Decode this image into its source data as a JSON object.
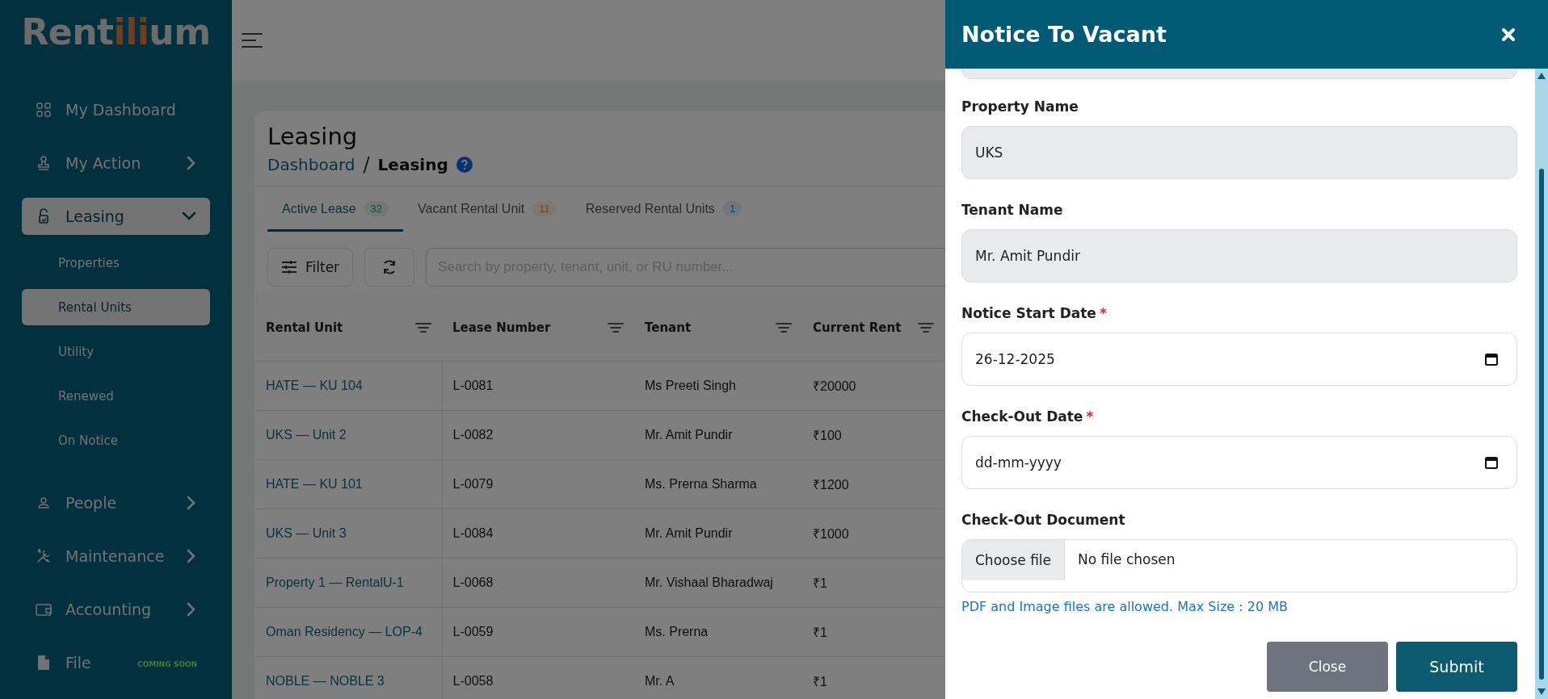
{
  "sidebar": {
    "logo": {
      "start": "Rent",
      "accent": "ili",
      "end": "um"
    },
    "items": [
      {
        "label": "My Dashboard",
        "selected": false
      },
      {
        "label": "My Action",
        "selected": false,
        "expanded": false
      },
      {
        "label": "Leasing",
        "selected": true,
        "expanded": true,
        "children": [
          {
            "label": "Properties",
            "selected": false
          },
          {
            "label": "Rental Units",
            "selected": true
          },
          {
            "label": "Utility",
            "selected": false
          },
          {
            "label": "Renewed",
            "selected": false
          },
          {
            "label": "On Notice",
            "selected": false
          }
        ]
      },
      {
        "label": "People",
        "selected": false,
        "expanded": false
      },
      {
        "label": "Maintenance",
        "selected": false,
        "expanded": false
      },
      {
        "label": "Accounting",
        "selected": false,
        "expanded": false
      },
      {
        "label": "File",
        "selected": false,
        "badge": "COMING SOON"
      }
    ]
  },
  "page": {
    "title": "Leasing",
    "breadcrumb": [
      {
        "label": "Dashboard",
        "kind": "link"
      },
      {
        "label": "/",
        "kind": "separator"
      },
      {
        "label": "Leasing",
        "kind": "current"
      }
    ],
    "tabs": [
      {
        "label": "Active Lease",
        "count": "32",
        "selected": true
      },
      {
        "label": "Vacant Rental Unit",
        "count": "11",
        "selected": false
      },
      {
        "label": "Reserved Rental Units",
        "count": "1",
        "selected": false
      }
    ],
    "toolbar": {
      "filter_label": "Filter",
      "search": {
        "placeholder": "Search by property, tenant, unit, or RU number..."
      }
    },
    "table": {
      "columns": [
        "Rental Unit",
        "Lease Number",
        "Tenant",
        "Current Rent"
      ],
      "rows": [
        [
          "HATE — KU 104",
          "L-0081",
          "Ms Preeti Singh",
          "₹20000"
        ],
        [
          "UKS — Unit 2",
          "L-0082",
          "Mr. Amit Pundir",
          "₹100"
        ],
        [
          "HATE — KU 101",
          "L-0079",
          "Ms. Prerna Sharma",
          "₹1200"
        ],
        [
          "UKS — Unit 3",
          "L-0084",
          "Mr. Amit Pundir",
          "₹1000"
        ],
        [
          "Property 1 — RentalU-1",
          "L-0068",
          "Mr. Vishaal Bharadwaj",
          "₹1"
        ],
        [
          "Oman Residency — LOP-4",
          "L-0059",
          "Ms. Prerna",
          "₹1"
        ],
        [
          "NOBLE — NOBLE 3",
          "L-0058",
          "Mr. A",
          "₹1"
        ]
      ]
    }
  },
  "modal": {
    "title": "Notice To Vacant",
    "fields": [
      {
        "label": "Property Name",
        "kind": "text",
        "value": "UKS",
        "disabled": true,
        "required": false
      },
      {
        "label": "Tenant Name",
        "kind": "text",
        "value": "Mr. Amit Pundir",
        "disabled": true,
        "required": false
      },
      {
        "label": "Notice Start Date",
        "kind": "date",
        "value": "26-12-2025",
        "disabled": false,
        "required": true
      },
      {
        "label": "Check-Out Date",
        "kind": "date",
        "placeholder": "dd-mm-yyyy",
        "disabled": false,
        "required": true
      },
      {
        "label": "Check-Out Document",
        "kind": "file",
        "button": "Choose file",
        "value": "No file chosen",
        "required": false
      }
    ],
    "required_mark": "*",
    "hint": "PDF and Image files are allowed. Max Size : 20 MB",
    "buttons": [
      {
        "label": "Close",
        "kind": "secondary"
      },
      {
        "label": "Submit",
        "kind": "primary"
      }
    ]
  }
}
